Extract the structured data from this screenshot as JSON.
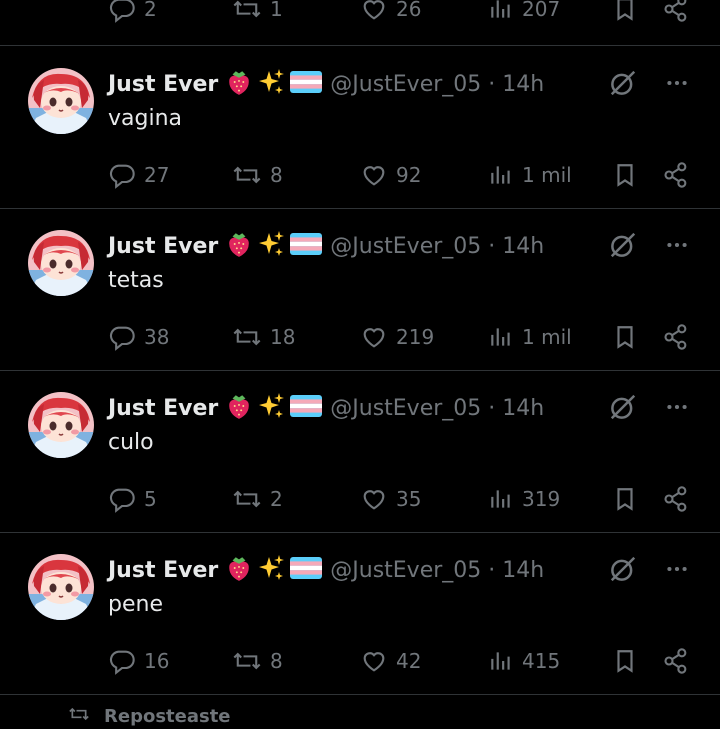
{
  "top_partial": {
    "replies": "2",
    "reposts": "1",
    "likes": "26",
    "views": "207"
  },
  "tweets": [
    {
      "name": "Just Ever",
      "handle": "@JustEver_05 · 14h",
      "text": "vagina",
      "replies": "27",
      "reposts": "8",
      "likes": "92",
      "views": "1 mil"
    },
    {
      "name": "Just Ever",
      "handle": "@JustEver_05 · 14h",
      "text": "tetas",
      "replies": "38",
      "reposts": "18",
      "likes": "219",
      "views": "1 mil"
    },
    {
      "name": "Just Ever",
      "handle": "@JustEver_05 · 14h",
      "text": "culo",
      "replies": "5",
      "reposts": "2",
      "likes": "35",
      "views": "319"
    },
    {
      "name": "Just Ever",
      "handle": "@JustEver_05 · 14h",
      "text": "pene",
      "replies": "16",
      "reposts": "8",
      "likes": "42",
      "views": "415"
    }
  ],
  "bottom": {
    "label": "Reposteaste"
  },
  "icons": {
    "emoji": [
      "strawberry-emoji",
      "sparkles-emoji",
      "trans-flag-emoji"
    ],
    "actions": [
      "reply-icon",
      "repost-icon",
      "like-icon",
      "views-icon",
      "bookmark-icon",
      "share-icon"
    ],
    "header": [
      "grok-icon",
      "more-icon"
    ]
  },
  "colors": {
    "background": "#000000",
    "text": "#e7e9ea",
    "muted": "#71767b",
    "divider": "#2f3336"
  }
}
